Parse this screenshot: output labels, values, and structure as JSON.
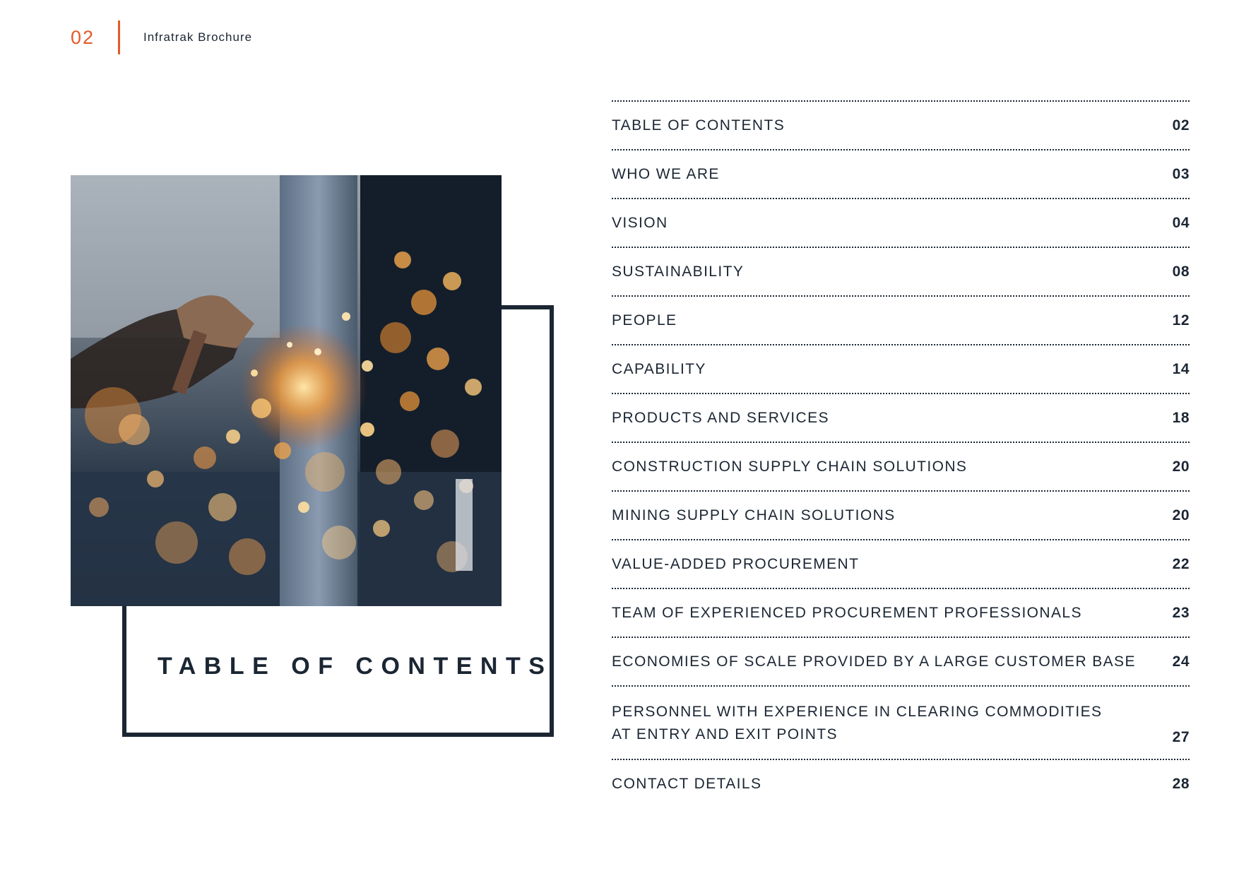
{
  "header": {
    "page_number": "02",
    "document_title": "Infratrak Brochure"
  },
  "feature": {
    "title": "TABLE OF CONTENTS",
    "image_alt": "photo-welding-sparks"
  },
  "toc": [
    {
      "label": "TABLE OF CONTENTS",
      "page": "02"
    },
    {
      "label": "WHO WE ARE",
      "page": "03"
    },
    {
      "label": "VISION",
      "page": "04"
    },
    {
      "label": "SUSTAINABILITY",
      "page": "08"
    },
    {
      "label": "PEOPLE",
      "page": "12"
    },
    {
      "label": "CAPABILITY",
      "page": "14"
    },
    {
      "label": "PRODUCTS AND SERVICES",
      "page": "18"
    },
    {
      "label": "CONSTRUCTION SUPPLY CHAIN SOLUTIONS",
      "page": "20"
    },
    {
      "label": "MINING SUPPLY CHAIN SOLUTIONS",
      "page": "20"
    },
    {
      "label": "VALUE-ADDED PROCUREMENT",
      "page": "22"
    },
    {
      "label": "TEAM OF EXPERIENCED PROCUREMENT PROFESSIONALS",
      "page": "23"
    },
    {
      "label": "ECONOMIES OF SCALE PROVIDED BY A LARGE CUSTOMER BASE",
      "page": "24"
    },
    {
      "label": "PERSONNEL WITH EXPERIENCE IN CLEARING COMMODITIES",
      "label2": "AT ENTRY AND EXIT POINTS",
      "page": "27"
    },
    {
      "label": "CONTACT DETAILS",
      "page": "28"
    }
  ],
  "colors": {
    "accent": "#e35a2b",
    "ink": "#1b2633"
  }
}
